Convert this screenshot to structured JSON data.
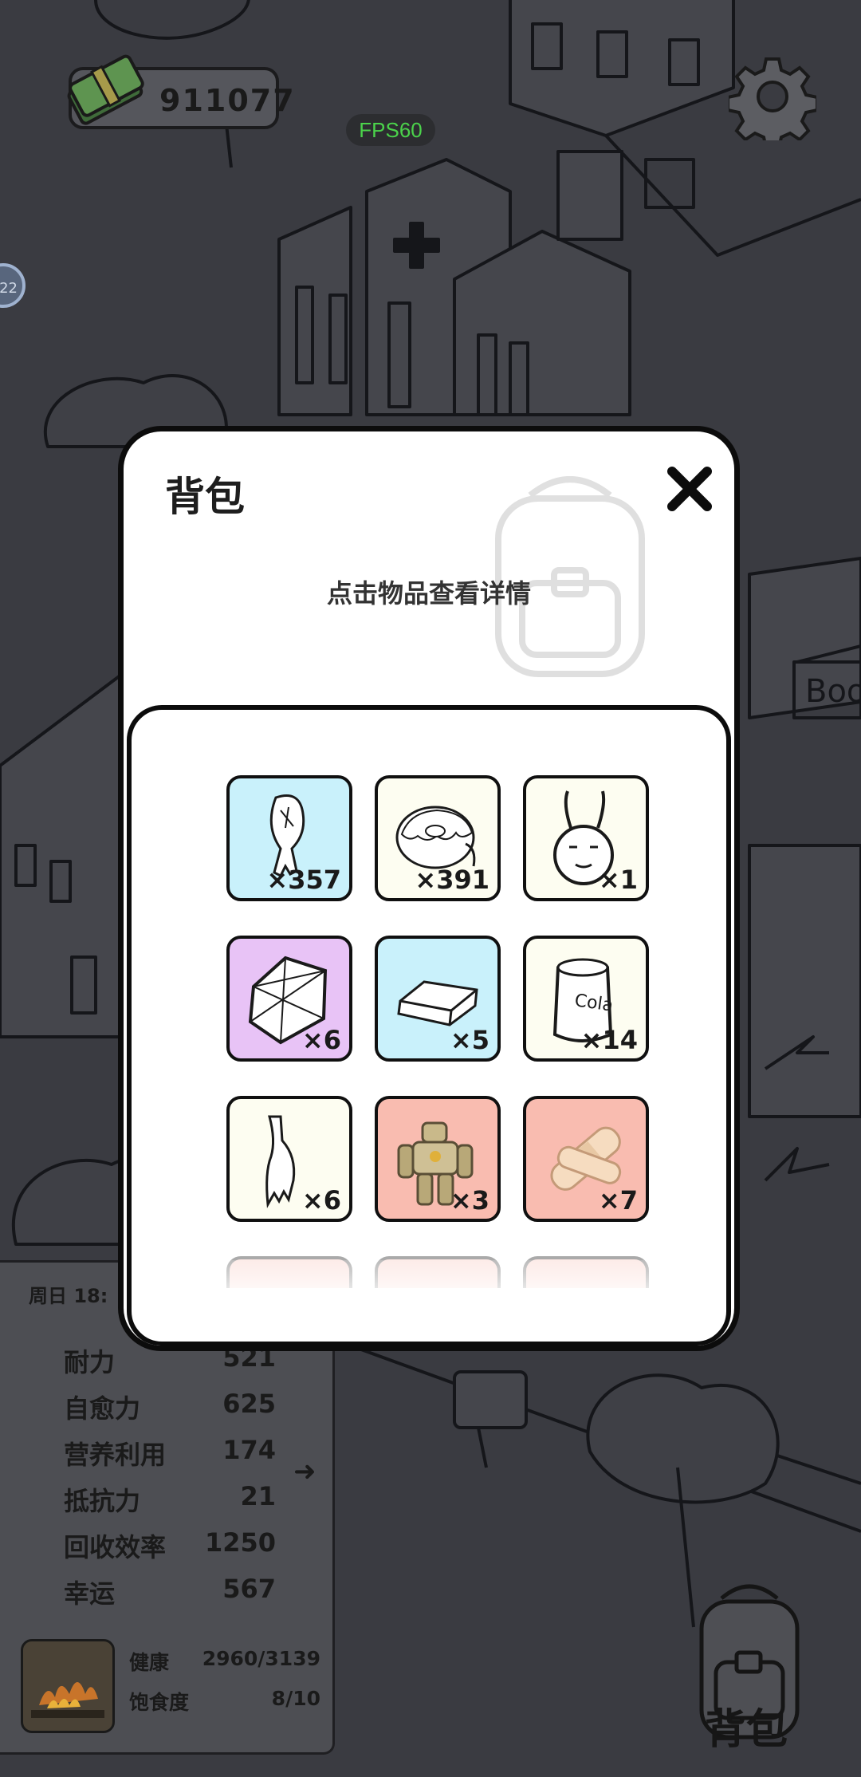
{
  "hud": {
    "money": "911077",
    "fps": "FPS60",
    "side_badge": "22"
  },
  "stats_panel": {
    "time": "周日 18:",
    "rows": [
      {
        "label": "耐力",
        "value": "521"
      },
      {
        "label": "自愈力",
        "value": "625"
      },
      {
        "label": "营养利用",
        "value": "174"
      },
      {
        "label": "抵抗力",
        "value": "21"
      },
      {
        "label": "回收效率",
        "value": "1250"
      },
      {
        "label": "幸运",
        "value": "567"
      }
    ],
    "vitals": [
      {
        "label": "健康",
        "value": "2960/3139"
      },
      {
        "label": "饱食度",
        "value": "8/10"
      }
    ]
  },
  "bag_button": {
    "label": "背包"
  },
  "modal": {
    "title": "背包",
    "hint": "点击物品查看详情",
    "items": [
      {
        "name": "chicken-leg",
        "qty": "×357",
        "bg": "#c9f1fb"
      },
      {
        "name": "donut",
        "qty": "×391",
        "bg": "#fdfdf1"
      },
      {
        "name": "antenna-creature",
        "qty": "×1",
        "bg": "#fdfdf1"
      },
      {
        "name": "crystal",
        "qty": "×6",
        "bg": "#e8c3f6"
      },
      {
        "name": "silver-bar",
        "qty": "×5",
        "bg": "#c9f1fb"
      },
      {
        "name": "cola-can",
        "qty": "×14",
        "bg": "#fdfdf1"
      },
      {
        "name": "broken-bottle",
        "qty": "×6",
        "bg": "#fdfdf1"
      },
      {
        "name": "mech-robot",
        "qty": "×3",
        "bg": "#f9bcb0"
      },
      {
        "name": "bandage",
        "qty": "×7",
        "bg": "#f9bcb0"
      }
    ]
  }
}
